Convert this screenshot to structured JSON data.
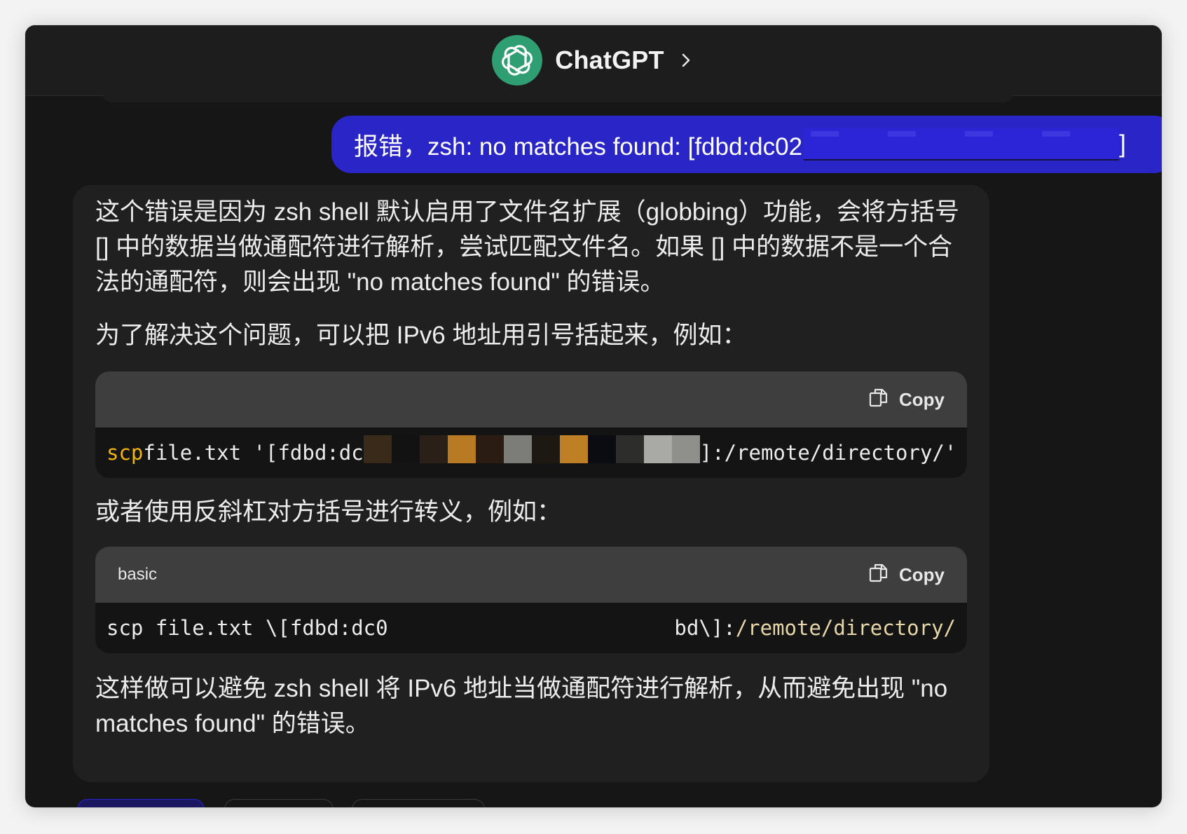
{
  "header": {
    "title": "ChatGPT",
    "title_chevron_icon": "chevron-right-icon",
    "logo_icon": "openai-logo-icon"
  },
  "user_message": {
    "text": "报错，zsh: no matches found: [fdbd:dc02",
    "text_end": "]"
  },
  "assistant_message": {
    "para1": "这个错误是因为 zsh shell 默认启用了文件名扩展（globbing）功能，会将方括号 [] 中的数据当做通配符进行解析，尝试匹配文件名。如果 [] 中的数据不是一个合法的通配符，则会出现 \"no matches found\" 的错误。",
    "para2": "为了解决这个问题，可以把 IPv6 地址用引号括起来，例如：",
    "code1": {
      "language": "",
      "copy_label": "Copy",
      "kw": "scp",
      "pre": " file.txt '[fdbd:dc",
      "post": "]:/remote/directory/'",
      "redaction_colors": [
        "#3a2a1a",
        "#121212",
        "#2a2018",
        "#b97a24",
        "#2a1c12",
        "#7c7c78",
        "#1e1812",
        "#bf7f24",
        "#0a0c12",
        "#2d2d2b",
        "#a9a9a5",
        "#8f8f8b"
      ]
    },
    "para3": "或者使用反斜杠对方括号进行转义，例如：",
    "code2": {
      "language": "basic",
      "copy_label": "Copy",
      "pre": "scp file.txt \\[fdbd:dc0",
      "mid": "bd\\]:",
      "path": "/remote/directory/"
    },
    "para4": "这样做可以避免 zsh shell 将 IPv6 地址当做通配符进行解析，从而避免出现 \"no matches found\" 的错误。"
  }
}
